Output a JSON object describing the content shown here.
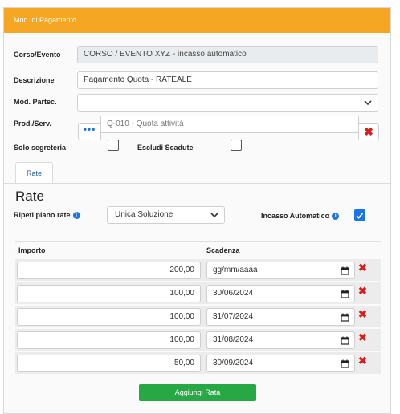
{
  "header": {
    "title": "Mod. di Pagamento"
  },
  "form": {
    "corso_label": "Corso/Evento",
    "corso_value": "CORSO / EVENTO XYZ - incasso automatico",
    "descrizione_label": "Descrizione",
    "descrizione_value": "Pagamento Quota - RATEALE",
    "mod_partec_label": "Mod. Partec.",
    "mod_partec_value": "",
    "prod_label": "Prod./Serv.",
    "prod_dots": "•••",
    "prod_value": "Q-010 - Quota attività",
    "solo_segreteria_label": "Solo segreteria",
    "solo_segreteria_checked": false,
    "escludi_scadute_label": "Escludi Scadute",
    "escludi_scadute_checked": false
  },
  "tabs": [
    {
      "label": "Rate",
      "active": true
    }
  ],
  "rate": {
    "heading": "Rate",
    "ripeti_label": "Ripeti piano rate",
    "ripeti_value": "Unica Soluzione",
    "incasso_label": "Incasso Automatico",
    "incasso_checked": true,
    "info_glyph": "i",
    "col_importo": "Importo",
    "col_scadenza": "Scadenza",
    "rows": [
      {
        "importo": "200,00",
        "scadenza": "gg/mm/aaaa"
      },
      {
        "importo": "100,00",
        "scadenza": "30/06/2024"
      },
      {
        "importo": "100,00",
        "scadenza": "31/07/2024"
      },
      {
        "importo": "100,00",
        "scadenza": "31/08/2024"
      },
      {
        "importo": "50,00",
        "scadenza": "30/09/2024"
      }
    ],
    "delete_glyph": "✖",
    "add_button": "Aggiungi Rata"
  },
  "colors": {
    "header": "#f5a623",
    "accent": "#1a73e8",
    "danger": "#d81b1b",
    "success": "#28a745"
  }
}
